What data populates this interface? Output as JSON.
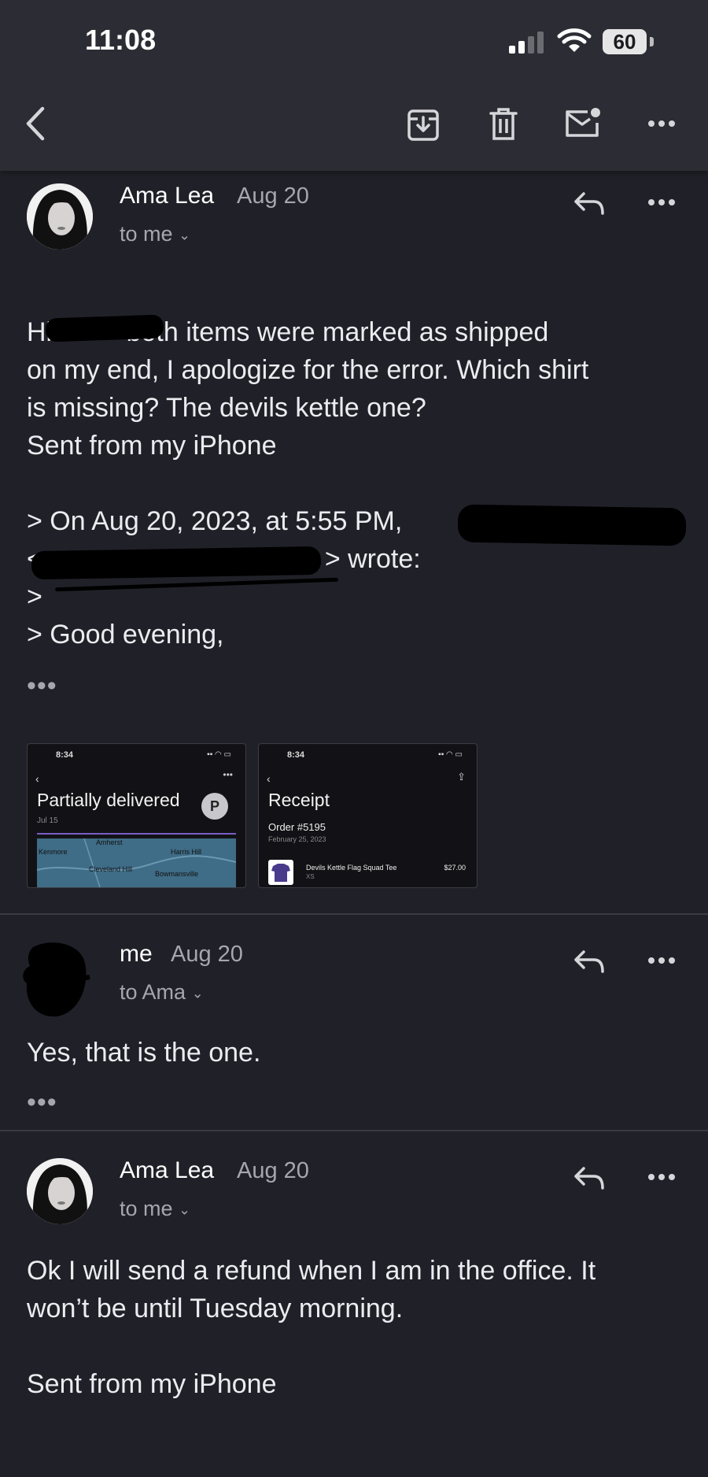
{
  "status_bar": {
    "time": "11:08",
    "battery": "60"
  },
  "toolbar": {
    "back_icon": "chevron-left-icon",
    "archive_icon": "archive-icon",
    "delete_icon": "trash-icon",
    "mark_unread_icon": "mail-unread-icon",
    "more_icon": "more-icon"
  },
  "messages": [
    {
      "sender": "Ama Lea",
      "date": "Aug 20",
      "recipient": "to me",
      "body": "Hi          both items were marked as shipped\non my end, I apologize for the error. Which shirt\nis missing? The devils kettle one?\nSent from my iPhone\n\n> On Aug 20, 2023, at 5:55 PM,\n<                                      > wrote:\n>\n> Good evening,",
      "ellipsis": "•••",
      "attachments": [
        {
          "time": "8:34",
          "title": "Partially delivered",
          "subtitle": "Jul 15",
          "badge": "P",
          "map_labels": [
            "Amherst",
            "Kenmore",
            "Harris Hill",
            "Cleveland Hill",
            "Bowmansville"
          ]
        },
        {
          "time": "8:34",
          "title": "Receipt",
          "order": "Order #5195",
          "subtitle": "February 25, 2023",
          "item_name": "Devils Kettle Flag Squad Tee",
          "item_size": "XS",
          "item_price": "$27.00"
        }
      ]
    },
    {
      "sender": "me",
      "date": "Aug 20",
      "recipient": "to Ama",
      "body": "Yes, that is the one.",
      "ellipsis": "•••"
    },
    {
      "sender": "Ama Lea",
      "date": "Aug 20",
      "recipient": "to me",
      "body": "Ok I will send a refund when I am in the office. It\nwon’t be until Tuesday morning.\n\nSent from my iPhone"
    }
  ]
}
